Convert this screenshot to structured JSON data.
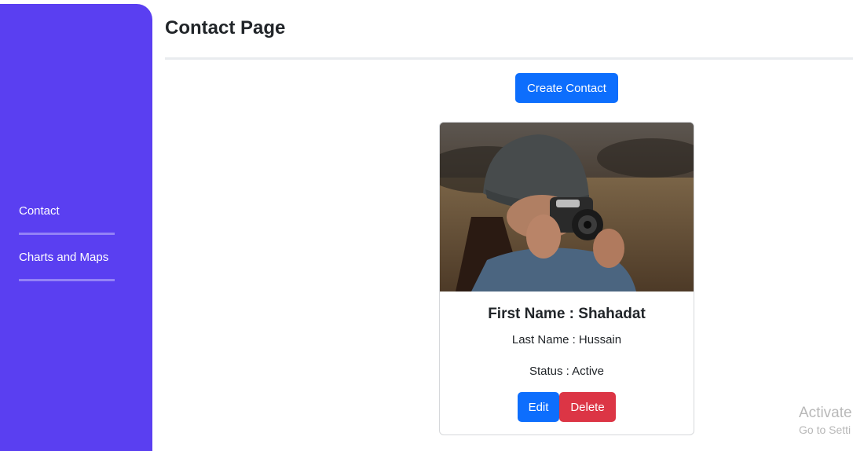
{
  "page": {
    "title": "Contact Page"
  },
  "sidebar": {
    "items": [
      {
        "label": "Contact"
      },
      {
        "label": "Charts and Maps"
      }
    ]
  },
  "actions": {
    "create_label": "Create Contact"
  },
  "contact_card": {
    "first_name_text": "First Name : Shahadat",
    "last_name_text": "Last Name : Hussain",
    "status_text": "Status : Active",
    "edit_label": "Edit",
    "delete_label": "Delete"
  },
  "watermark": {
    "title": "Activate",
    "subtitle": "Go to Setti"
  },
  "colors": {
    "sidebar": "#5a3ff1",
    "primary": "#0d6efd",
    "danger": "#dc3545"
  }
}
